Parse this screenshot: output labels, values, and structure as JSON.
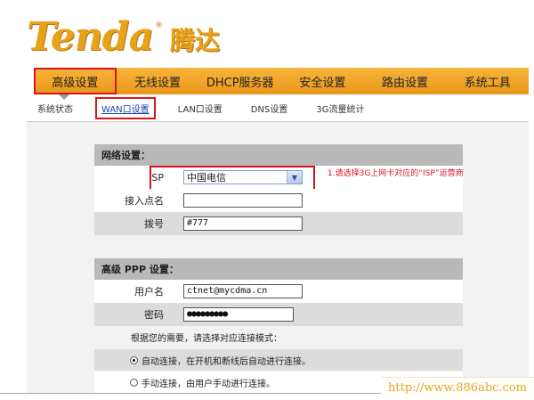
{
  "brand": {
    "name_en": "Tenda",
    "name_cn": "腾达",
    "mark": "®"
  },
  "nav": {
    "items": [
      {
        "label": "高级设置"
      },
      {
        "label": "无线设置"
      },
      {
        "label": "DHCP服务器"
      },
      {
        "label": "安全设置"
      },
      {
        "label": "路由设置"
      },
      {
        "label": "系统工具"
      }
    ]
  },
  "subnav": {
    "items": [
      {
        "label": "系统状态"
      },
      {
        "label": "WAN口设置"
      },
      {
        "label": "LAN口设置"
      },
      {
        "label": "DNS设置"
      },
      {
        "label": "3G流量统计"
      }
    ]
  },
  "network": {
    "header": "网络设置：",
    "isp_label": "ISP",
    "isp_value": "中国电信",
    "apn_label": "接入点名",
    "apn_value": "",
    "dial_label": "拨号",
    "dial_value": "#777",
    "annotation": "1.请选择3G上网卡对应的“ISP”运营商"
  },
  "ppp": {
    "header": "高级 PPP 设置：",
    "user_label": "用户名",
    "user_value": "ctnet@mycdma.cn",
    "pass_label": "密码",
    "pass_value": "●●●●●●●●●"
  },
  "mode": {
    "prompt": "根据您的需要，请选择对应连接模式：",
    "auto_label": "自动连接，在开机和断线后自动进行连接。",
    "manual_label": "手动连接，由用户手动进行连接。"
  },
  "watermark": "http://www.886abc.com",
  "colors": {
    "nav": "#f0a62a",
    "highlight": "#d8141b",
    "section": "#b9b9b9"
  }
}
